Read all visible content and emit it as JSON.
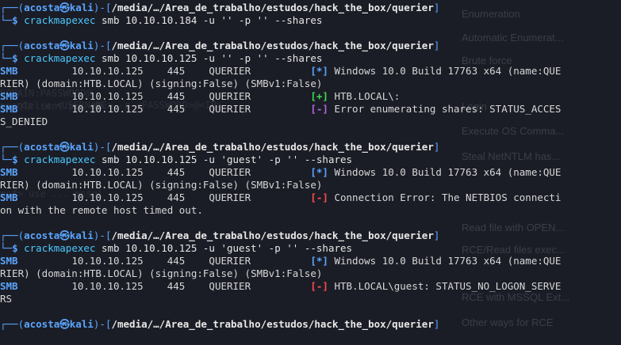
{
  "prompt": {
    "user": "acosta",
    "host": "kali",
    "path": "/media/…/Area_de_trabalho/estudos/hack_the_box/querier",
    "dollar": "$"
  },
  "commands": [
    {
      "tool": "crackmapexec",
      "args": "smb 10.10.10.184 -u '' -p '' --shares"
    },
    {
      "tool": "crackmapexec",
      "args": "smb 10.10.10.125 -u '' -p '' --shares"
    },
    {
      "tool": "crackmapexec",
      "args": "smb 10.10.10.125 -u 'guest' -p '' --shares"
    },
    {
      "tool": "crackmapexec",
      "args": "smb 10.10.10.125 -u 'guest' -p '' --shares"
    }
  ],
  "outputs": {
    "o2": [
      {
        "proto": "SMB",
        "ip": "10.10.10.125",
        "port": "445",
        "name": "QUERIER",
        "tag": "[*]",
        "msg": "Windows 10.0 Build 17763 x64 (name:QUE"
      },
      {
        "plain": "RIER) (domain:HTB.LOCAL) (signing:False) (SMBv1:False)"
      },
      {
        "proto": "SMB",
        "ip": "10.10.10.125",
        "port": "445",
        "name": "QUERIER",
        "tag": "[+]",
        "msg": "HTB.LOCAL\\:"
      },
      {
        "proto": "SMB",
        "ip": "10.10.10.125",
        "port": "445",
        "name": "QUERIER",
        "tag": "[-]",
        "msg": "Error enumerating shares: STATUS_ACCES"
      },
      {
        "plain": "S_DENIED"
      }
    ],
    "o3": [
      {
        "proto": "SMB",
        "ip": "10.10.10.125",
        "port": "445",
        "name": "QUERIER",
        "tag": "[*]",
        "msg": "Windows 10.0 Build 17763 x64 (name:QUE"
      },
      {
        "plain": "RIER) (domain:HTB.LOCAL) (signing:False) (SMBv1:False)"
      },
      {
        "proto": "SMB",
        "ip": "10.10.10.125",
        "port": "445",
        "name": "QUERIER",
        "tag": "[-]",
        "msg": "Connection Error: The NETBIOS connecti"
      },
      {
        "plain": "on with the remote host timed out."
      }
    ],
    "o4": [
      {
        "proto": "SMB",
        "ip": "10.10.10.125",
        "port": "445",
        "name": "QUERIER",
        "tag": "[*]",
        "msg": "Windows 10.0 Build 17763 x64 (name:QUE"
      },
      {
        "plain": "RIER) (domain:HTB.LOCAL) (signing:False) (SMBv1:False)"
      },
      {
        "proto": "SMB",
        "ip": "10.10.10.125",
        "port": "445",
        "name": "QUERIER",
        "tag": "[-]",
        "msg": "HTB.LOCAL\\guest: STATUS_NO_LOGON_SERVE"
      },
      {
        "plain": "RS"
      }
    ]
  },
  "ghost_menu": [
    "Enumeration",
    "Automatic Enumerat...",
    "Brute force",
    "Login",
    "Execute OS Comma...",
    "Steal NetNTLM has...",
    "Read file with OPEN...",
    "RCE/Read files exec...",
    "RCE with MSSQL Ext...",
    "Other ways for RCE"
  ],
  "ghost_left": [
    "DOMAIN:PASSWORD@",
    "mssqlclient.py -db",
    "rdp -u <USERNAME> -p <PASSWORD>@<IP>",
    "msf> use ... mssql"
  ],
  "colors": {
    "background": "#1b1d26",
    "prompt_blue": "#5aa5ff",
    "prompt_red": "#ff4a4a",
    "tag_green": "#3fd94f",
    "tag_purple": "#b266e0"
  }
}
